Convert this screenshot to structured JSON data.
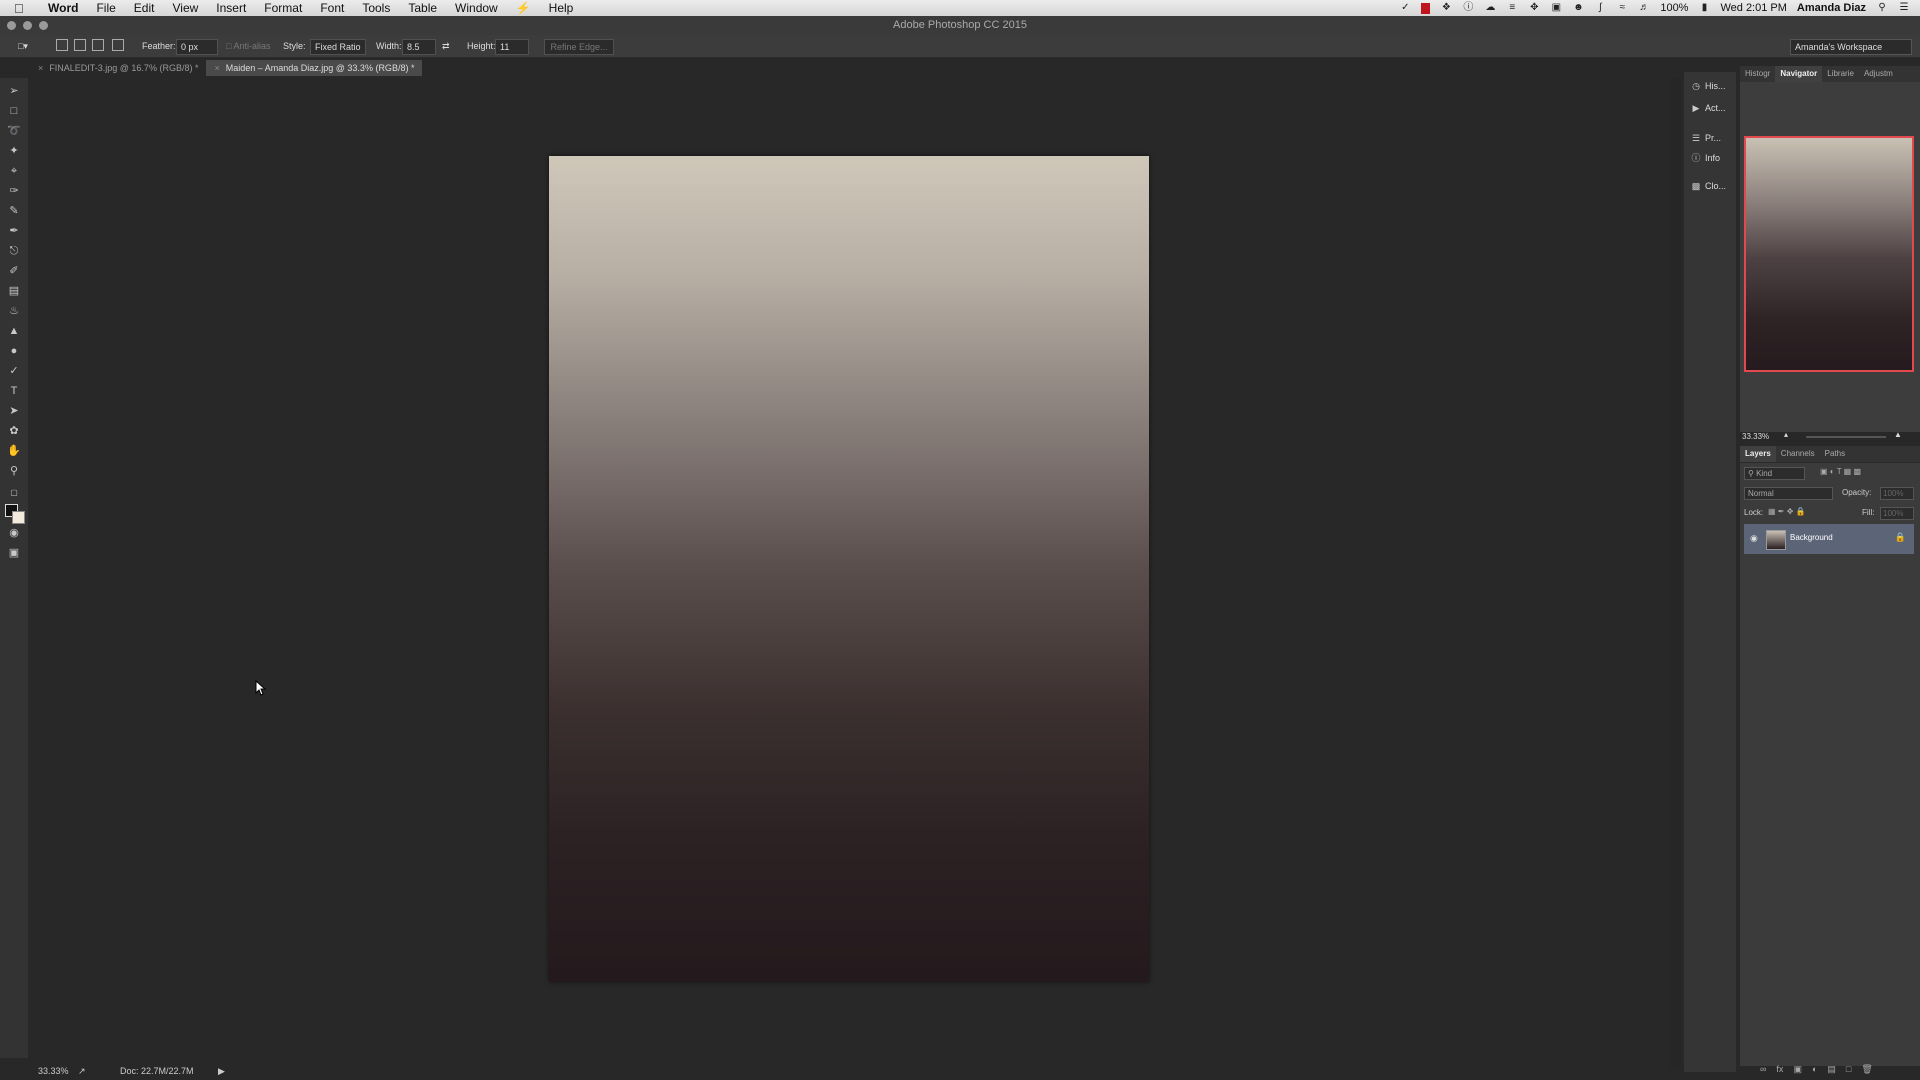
{
  "menubar": {
    "app": "Word",
    "items": [
      "File",
      "Edit",
      "View",
      "Insert",
      "Format",
      "Font",
      "Tools",
      "Table",
      "Window",
      "Help"
    ],
    "battery": "100%",
    "clock": "Wed 2:01 PM",
    "user": "Amanda Diaz"
  },
  "window": {
    "title": "Adobe Photoshop CC 2015"
  },
  "options": {
    "feather_label": "Feather:",
    "feather_value": "0 px",
    "antialias_label": "Anti-alias",
    "style_label": "Style:",
    "style_value": "Fixed Ratio",
    "width_label": "Width:",
    "width_value": "8.5",
    "height_label": "Height:",
    "height_value": "11",
    "refine_label": "Refine Edge...",
    "workspace": "Amanda's Workspace"
  },
  "tabs": [
    {
      "label": "FINALEDIT-3.jpg @ 16.7% (RGB/8) *"
    },
    {
      "label": "Maiden – Amanda Diaz.jpg @ 33.3% (RGB/8) *"
    }
  ],
  "status": {
    "zoom": "33.33%",
    "doc": "Doc: 22.7M/22.7M"
  },
  "strip": {
    "items": [
      "His...",
      "Act...",
      "Pr...",
      "Info",
      "Clo..."
    ]
  },
  "navigator": {
    "tabs": [
      "Histogr",
      "Navigator",
      "Librarie",
      "Adjustm"
    ],
    "zoom": "33.33%"
  },
  "layers": {
    "tabs": [
      "Layers",
      "Channels",
      "Paths"
    ],
    "kind": "Kind",
    "blend": "Normal",
    "opacity_label": "Opacity:",
    "opacity_value": "100%",
    "lock_label": "Lock:",
    "fill_label": "Fill:",
    "fill_value": "100%",
    "layer_name": "Background"
  }
}
